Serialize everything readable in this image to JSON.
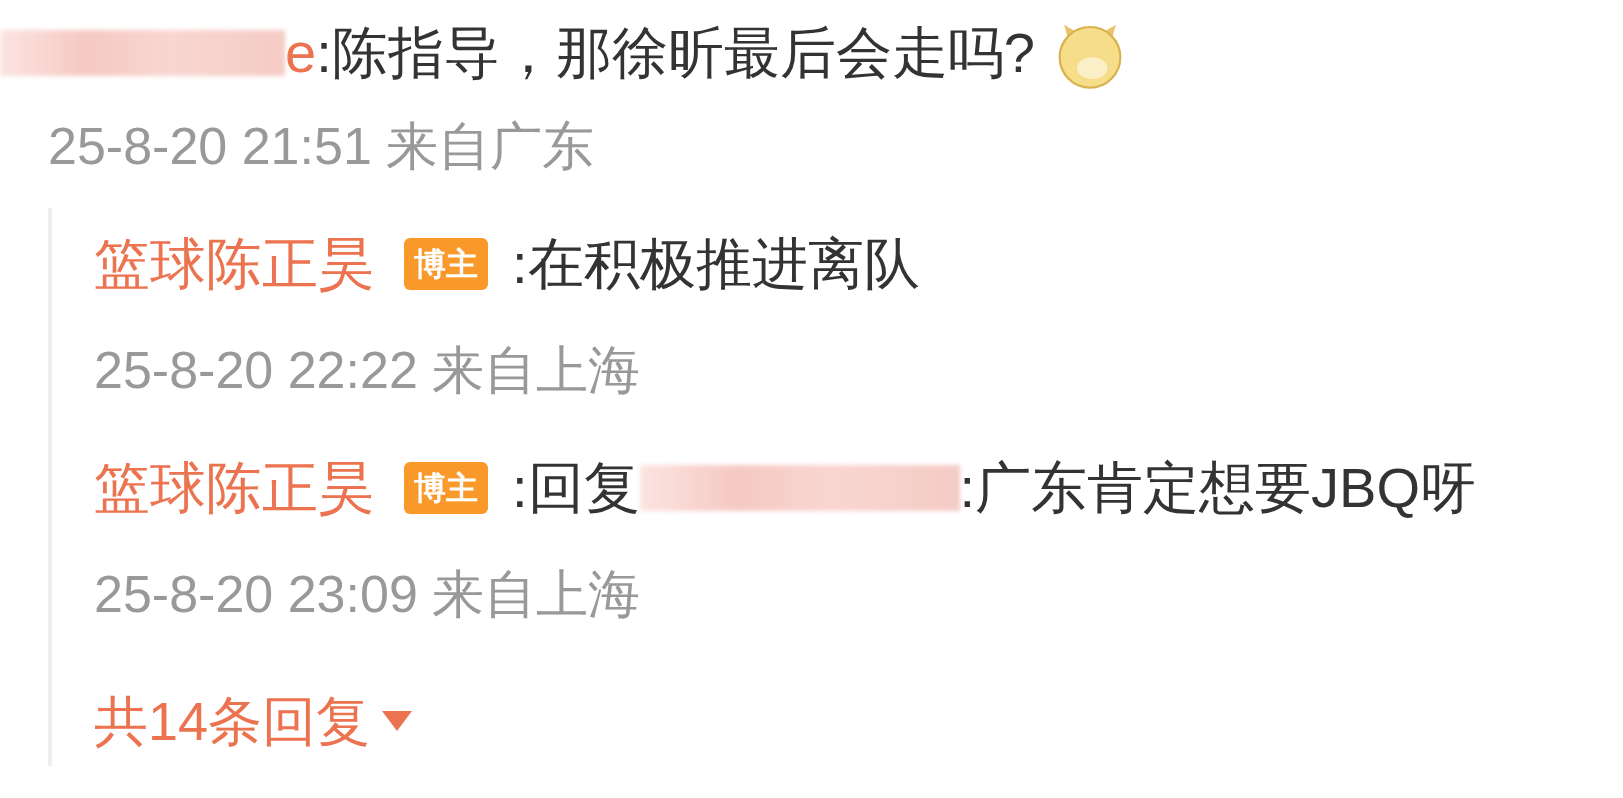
{
  "comment": {
    "author": "e",
    "author_redacted": true,
    "text": ":陈指导，那徐昕最后会走吗?",
    "emoji": true,
    "time": "25-8-20 21:51",
    "location": "来自广东"
  },
  "replies": [
    {
      "author": "篮球陈正昊",
      "badge": "博主",
      "mention_redacted": false,
      "text": ":在积极推进离队",
      "time": "25-8-20 22:22",
      "location": "来自上海"
    },
    {
      "author": "篮球陈正昊",
      "badge": "博主",
      "prefix": ":回复",
      "mention_redacted": true,
      "text": ":广东肯定想要JBQ呀",
      "time": "25-8-20 23:09",
      "location": "来自上海"
    }
  ],
  "more_replies": {
    "label": "共14条回复",
    "expanded": false
  }
}
